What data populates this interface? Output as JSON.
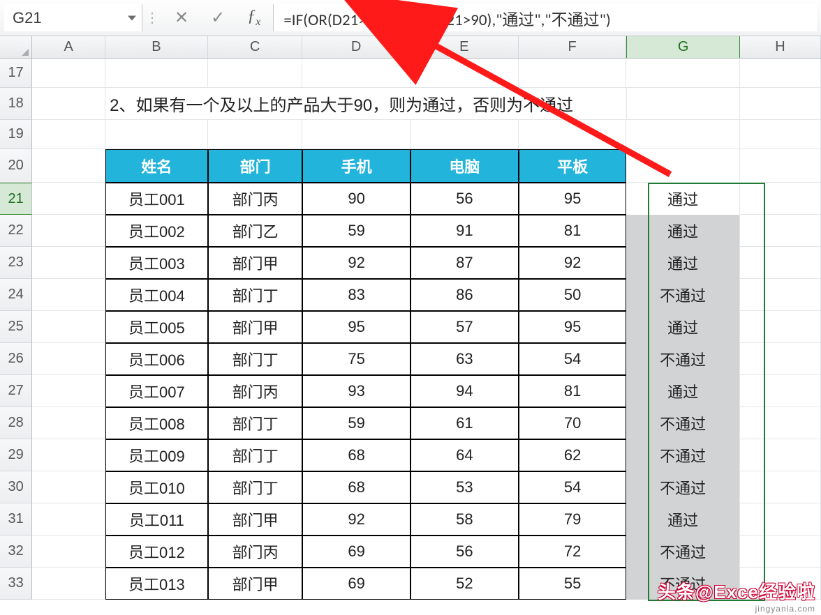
{
  "name_box": "G21",
  "formula": "=IF(OR(D21>90,E21>90,F21>90),\"通过\",\"不通过\")",
  "columns": [
    "A",
    "B",
    "C",
    "D",
    "E",
    "F",
    "G",
    "H"
  ],
  "selected_column": "G",
  "row_numbers": [
    17,
    18,
    19,
    20,
    21,
    22,
    23,
    24,
    25,
    26,
    27,
    28,
    29,
    30,
    31,
    32,
    33
  ],
  "selected_row": 21,
  "instruction": "2、如果有一个及以上的产品大于90，则为通过，否则为不通过",
  "table": {
    "headers": [
      "姓名",
      "部门",
      "手机",
      "电脑",
      "平板"
    ],
    "rows": [
      {
        "name": "员工001",
        "dept": "部门丙",
        "phone": 90,
        "pc": 56,
        "tablet": 95,
        "result": "通过"
      },
      {
        "name": "员工002",
        "dept": "部门乙",
        "phone": 59,
        "pc": 91,
        "tablet": 81,
        "result": "通过"
      },
      {
        "name": "员工003",
        "dept": "部门甲",
        "phone": 92,
        "pc": 87,
        "tablet": 92,
        "result": "通过"
      },
      {
        "name": "员工004",
        "dept": "部门丁",
        "phone": 83,
        "pc": 86,
        "tablet": 50,
        "result": "不通过"
      },
      {
        "name": "员工005",
        "dept": "部门甲",
        "phone": 95,
        "pc": 57,
        "tablet": 95,
        "result": "通过"
      },
      {
        "name": "员工006",
        "dept": "部门丁",
        "phone": 75,
        "pc": 63,
        "tablet": 54,
        "result": "不通过"
      },
      {
        "name": "员工007",
        "dept": "部门丙",
        "phone": 93,
        "pc": 94,
        "tablet": 81,
        "result": "通过"
      },
      {
        "name": "员工008",
        "dept": "部门丁",
        "phone": 59,
        "pc": 61,
        "tablet": 70,
        "result": "不通过"
      },
      {
        "name": "员工009",
        "dept": "部门丁",
        "phone": 68,
        "pc": 64,
        "tablet": 62,
        "result": "不通过"
      },
      {
        "name": "员工010",
        "dept": "部门丁",
        "phone": 68,
        "pc": 53,
        "tablet": 54,
        "result": "不通过"
      },
      {
        "name": "员工011",
        "dept": "部门甲",
        "phone": 92,
        "pc": 58,
        "tablet": 79,
        "result": "通过"
      },
      {
        "name": "员工012",
        "dept": "部门丙",
        "phone": 69,
        "pc": 56,
        "tablet": 72,
        "result": "不通过"
      },
      {
        "name": "员工013",
        "dept": "部门甲",
        "phone": 69,
        "pc": 52,
        "tablet": 55,
        "result": "不通过"
      }
    ]
  },
  "watermark": {
    "main": "头条@Exce经验啦",
    "sub": "jingyanla.com"
  },
  "icons": {
    "cancel": "✕",
    "confirm": "✓",
    "fx": "fx"
  }
}
